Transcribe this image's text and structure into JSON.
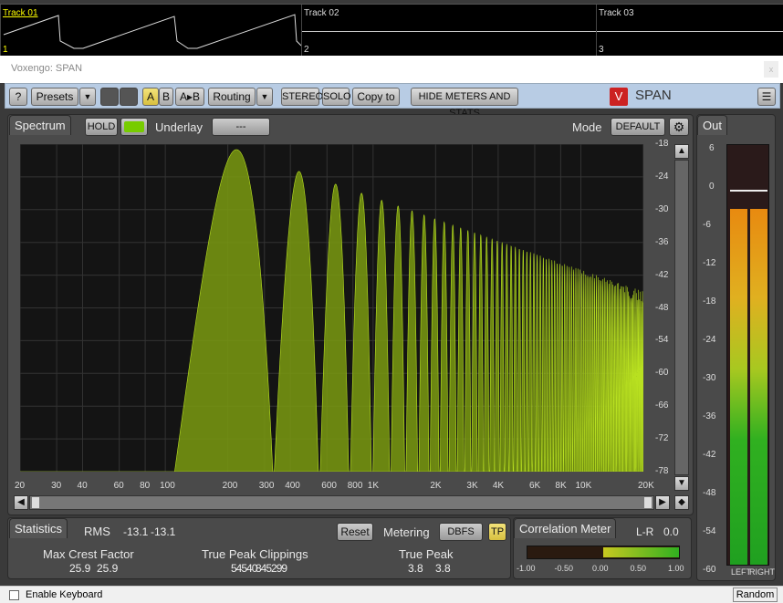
{
  "tracks": [
    {
      "name": "Track 01",
      "number": "1"
    },
    {
      "name": "Track 02",
      "number": "2"
    },
    {
      "name": "Track 03",
      "number": "3"
    }
  ],
  "window_title": "Voxengo: SPAN",
  "close_label": "x",
  "toolbar": {
    "help": "?",
    "presets": "Presets",
    "dropdown": "▼",
    "a": "A",
    "b": "B",
    "ab": "A▸B",
    "routing": "Routing",
    "stereo": "STEREO",
    "solo": "SOLO",
    "copy_to": "Copy to",
    "hide": "HIDE METERS AND STATS",
    "brand": "SPAN"
  },
  "spectrum": {
    "tab": "Spectrum",
    "hold": "HOLD",
    "underlay_label": "Underlay",
    "underlay_value": "---",
    "mode_label": "Mode",
    "mode_value": "DEFAULT",
    "db_ticks": [
      "-18",
      "-24",
      "-30",
      "-36",
      "-42",
      "-48",
      "-54",
      "-60",
      "-66",
      "-72",
      "-78"
    ],
    "freq_ticks": [
      "20",
      "30",
      "40",
      "60",
      "80",
      "100",
      "200",
      "300",
      "400",
      "600",
      "800",
      "1K",
      "2K",
      "3K",
      "4K",
      "6K",
      "8K",
      "10K",
      "20K"
    ],
    "fill_color": "#7a9a10",
    "line_color": "#b8e020",
    "fundamental_hz": 220,
    "peak_db_fundamental": -19,
    "peak_db_20k": -45
  },
  "out": {
    "tab": "Out",
    "ticks": [
      "6",
      "0",
      "-6",
      "-12",
      "-18",
      "-24",
      "-30",
      "-36",
      "-42",
      "-48",
      "-54",
      "-60"
    ],
    "level_db": -4,
    "hold_db": -1,
    "left": "LEFT",
    "right": "RIGHT"
  },
  "stats": {
    "tab": "Statistics",
    "rms_label": "RMS",
    "rms_l": "-13.1",
    "rms_r": "-13.1",
    "reset": "Reset",
    "metering_label": "Metering",
    "metering_value": "DBFS",
    "tp": "TP",
    "crest_label": "Max Crest Factor",
    "crest_l": "25.9",
    "crest_r": "25.9",
    "clip_label": "True Peak Clippings",
    "clip_l": "54540",
    "clip_r": "845299",
    "peak_label": "True Peak",
    "peak_l": "3.8",
    "peak_r": "3.8"
  },
  "correlation": {
    "tab": "Correlation Meter",
    "mode": "L-R",
    "value": "0.0",
    "ticks": [
      "-1.00",
      "-0.50",
      "0.00",
      "0.50",
      "1.00"
    ],
    "range": [
      0.0,
      1.0
    ]
  },
  "statusbar": {
    "keyboard": "Enable Keyboard",
    "random": "Random"
  }
}
